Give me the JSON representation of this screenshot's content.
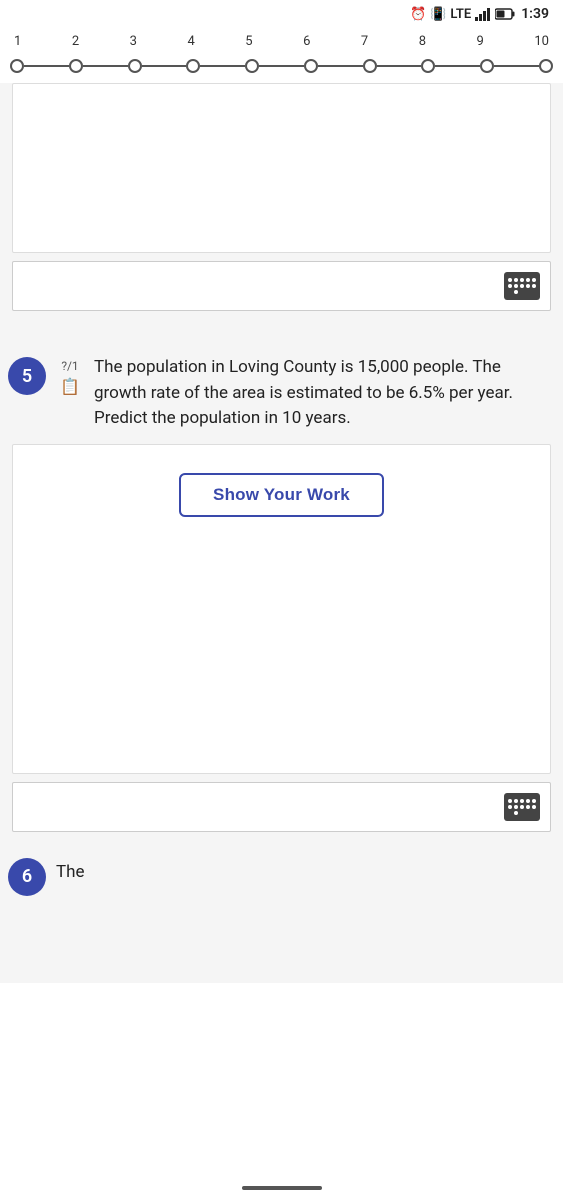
{
  "statusBar": {
    "time": "1:39",
    "signal": "LTE"
  },
  "navigation": {
    "items": [
      {
        "label": "1"
      },
      {
        "label": "2"
      },
      {
        "label": "3"
      },
      {
        "label": "4"
      },
      {
        "label": "5"
      },
      {
        "label": "6"
      },
      {
        "label": "7"
      },
      {
        "label": "8"
      },
      {
        "label": "9"
      },
      {
        "label": "10"
      }
    ]
  },
  "question5": {
    "number": "5",
    "points": "?/1",
    "text": "The population in Loving County is 15,000 people. The growth rate of the area is estimated to be 6.5% per year. Predict the population in 10 years.",
    "showWorkButton": "Show Your Work"
  },
  "question6": {
    "number": "6",
    "partial_text": "The"
  }
}
